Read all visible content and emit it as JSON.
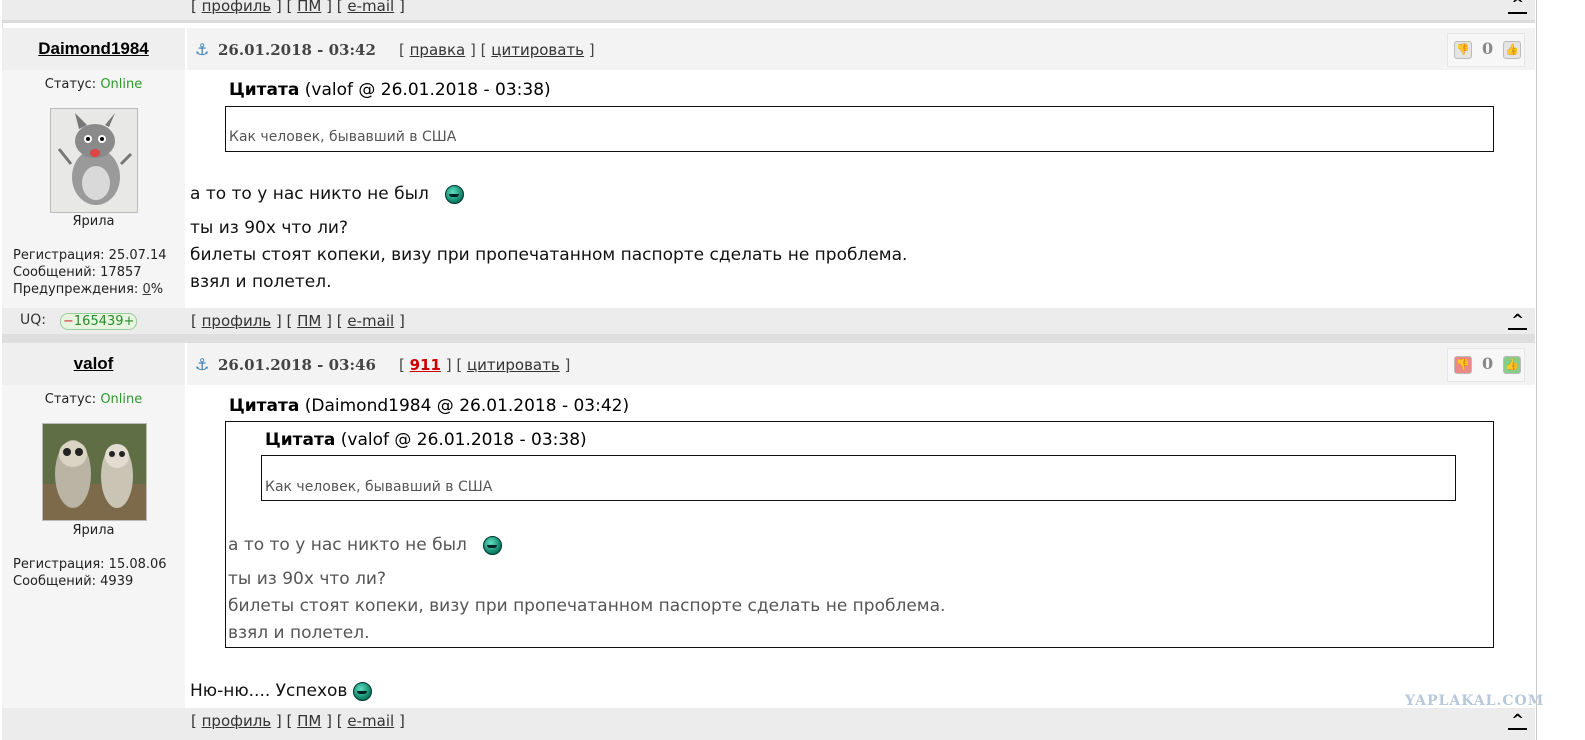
{
  "top_bar": {
    "profile": "профиль",
    "pm": "ПМ",
    "email": "e-mail",
    "up": "^"
  },
  "posts": [
    {
      "author": "Daimond1984",
      "date": "26.01.2018 - 03:42",
      "action1": "правка",
      "action2": "цитировать",
      "vote_count": "0",
      "status_label": "Статус:",
      "status_value": "Online",
      "rank": "Ярила",
      "reg": "Регистрация: 25.07.14",
      "msgs": "Сообщений: 17857",
      "warn_label": "Предупреждения:",
      "warn_value": "0",
      "warn_unit": "%",
      "quote": {
        "label": "Цитата",
        "source": "(valof @ 26.01.2018 - 03:38)",
        "text": "Как человек, бывавший в США"
      },
      "lines": [
        "а то то у нас никто не был",
        "ты из 90х что ли?",
        "билеты стоят копеки, визу при пропечатанном паспорте сделать не проблема.",
        "взял и полетел."
      ],
      "uq_label": "UQ:",
      "uq_value": "165439",
      "footer": {
        "profile": "профиль",
        "pm": "ПМ",
        "email": "e-mail",
        "up": "^"
      }
    },
    {
      "author": "valof",
      "date": "26.01.2018 - 03:46",
      "action1": "911",
      "action2": "цитировать",
      "vote_count": "0",
      "status_label": "Статус:",
      "status_value": "Online",
      "rank": "Ярила",
      "reg": "Регистрация: 15.08.06",
      "msgs": "Сообщений: 4939",
      "quote": {
        "label": "Цитата",
        "source": "(Daimond1984 @ 26.01.2018 - 03:42)",
        "inner": {
          "label": "Цитата",
          "source": "(valof @ 26.01.2018 - 03:38)",
          "text": "Как человек, бывавший в США"
        },
        "lines": [
          "а то то у нас никто не был",
          "ты из 90х что ли?",
          "билеты стоят копеки, визу при пропечатанном паспорте сделать не проблема.",
          "взял и полетел."
        ]
      },
      "reply": "Ню-ню.... Успехов",
      "footer": {
        "profile": "профиль",
        "pm": "ПМ",
        "email": "e-mail",
        "up": "^"
      }
    }
  ],
  "watermark": "YAPLAKAL.COM"
}
